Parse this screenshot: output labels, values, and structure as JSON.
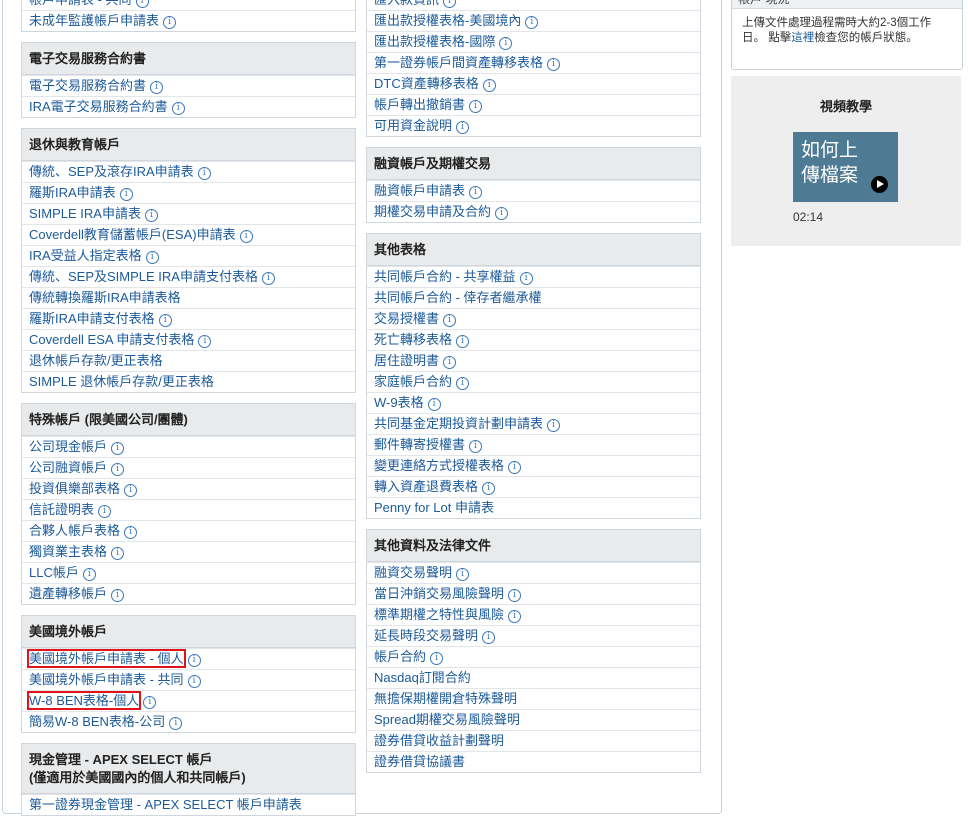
{
  "left_column": [
    {
      "heading": "",
      "items": [
        {
          "label": "帳戶申請表 - 共同",
          "info": true
        },
        {
          "label": "未成年監護帳戶申請表",
          "info": true
        }
      ]
    },
    {
      "heading": "電子交易服務合約書",
      "items": [
        {
          "label": "電子交易服務合約書",
          "info": true
        },
        {
          "label": "IRA電子交易服務合約書",
          "info": true
        }
      ]
    },
    {
      "heading": "退休與教育帳戶",
      "items": [
        {
          "label": "傳統、SEP及滾存IRA申請表",
          "info": true
        },
        {
          "label": "羅斯IRA申請表",
          "info": true
        },
        {
          "label": "SIMPLE IRA申請表",
          "info": true
        },
        {
          "label": "Coverdell教育儲蓄帳戶(ESA)申請表",
          "info": true
        },
        {
          "label": "IRA受益人指定表格",
          "info": true
        },
        {
          "label": "傳統、SEP及SIMPLE IRA申請支付表格",
          "info": true
        },
        {
          "label": "傳統轉換羅斯IRA申請表格",
          "info": false
        },
        {
          "label": "羅斯IRA申請支付表格",
          "info": true
        },
        {
          "label": "Coverdell ESA 申請支付表格",
          "info": true
        },
        {
          "label": "退休帳戶存款/更正表格",
          "info": false
        },
        {
          "label": "SIMPLE 退休帳戶存款/更正表格",
          "info": false
        }
      ]
    },
    {
      "heading": "特殊帳戶 (限美國公司/團體)",
      "items": [
        {
          "label": "公司現金帳戶",
          "info": true
        },
        {
          "label": "公司融資帳戶",
          "info": true
        },
        {
          "label": "投資俱樂部表格",
          "info": true
        },
        {
          "label": "信託證明表",
          "info": true
        },
        {
          "label": "合夥人帳戶表格",
          "info": true
        },
        {
          "label": "獨資業主表格",
          "info": true
        },
        {
          "label": "LLC帳戶",
          "info": true
        },
        {
          "label": "遺產轉移帳戶",
          "info": true
        }
      ]
    },
    {
      "heading": "美國境外帳戶",
      "items": [
        {
          "label": "美國境外帳戶申請表 - 個人",
          "info": true,
          "highlight": true
        },
        {
          "label": "美國境外帳戶申請表 - 共同",
          "info": true
        },
        {
          "label": "W-8 BEN表格-個人",
          "info": true,
          "highlight": true
        },
        {
          "label": "簡易W-8 BEN表格-公司",
          "info": true
        }
      ]
    },
    {
      "heading": "現金管理 - APEX SELECT 帳戶",
      "subheading": "(僅適用於美國國內的個人和共同帳戶)",
      "items": [
        {
          "label": "第一證券現金管理 - APEX SELECT 帳戶申請表",
          "info": false
        }
      ]
    }
  ],
  "mid_column": [
    {
      "heading": "",
      "items": [
        {
          "label": "匯入款資訊",
          "info": true
        },
        {
          "label": "匯出款授權表格-美國境內",
          "info": true
        },
        {
          "label": "匯出款授權表格-國際",
          "info": true
        },
        {
          "label": "第一證券帳戶間資產轉移表格",
          "info": true
        },
        {
          "label": "DTC資產轉移表格",
          "info": true
        },
        {
          "label": "帳戶轉出撤銷書",
          "info": true
        },
        {
          "label": "可用資金說明",
          "info": true
        }
      ]
    },
    {
      "heading": "融資帳戶及期權交易",
      "items": [
        {
          "label": "融資帳戶申請表",
          "info": true
        },
        {
          "label": "期權交易申請及合約",
          "info": true
        }
      ]
    },
    {
      "heading": "其他表格",
      "items": [
        {
          "label": "共同帳戶合約 - 共享權益",
          "info": true
        },
        {
          "label": "共同帳戶合約 - 倖存者繼承權",
          "info": false
        },
        {
          "label": "交易授權書",
          "info": true
        },
        {
          "label": "死亡轉移表格",
          "info": true
        },
        {
          "label": "居住證明書",
          "info": true
        },
        {
          "label": "家庭帳戶合約",
          "info": true
        },
        {
          "label": "W-9表格",
          "info": true
        },
        {
          "label": "共同基金定期投資計劃申請表",
          "info": true
        },
        {
          "label": "郵件轉寄授權書",
          "info": true
        },
        {
          "label": "變更連絡方式授權表格",
          "info": true
        },
        {
          "label": "轉入資產退費表格",
          "info": true
        },
        {
          "label": "Penny for Lot 申請表",
          "info": false
        }
      ]
    },
    {
      "heading": "其他資料及法律文件",
      "items": [
        {
          "label": "融資交易聲明",
          "info": true
        },
        {
          "label": "當日沖銷交易風險聲明",
          "info": true
        },
        {
          "label": "標準期權之特性與風險",
          "info": true
        },
        {
          "label": "延長時段交易聲明",
          "info": true
        },
        {
          "label": "帳戶合約",
          "info": true
        },
        {
          "label": "Nasdaq訂閱合約",
          "info": false
        },
        {
          "label": "無擔保期權開倉特殊聲明",
          "info": false
        },
        {
          "label": "Spread期權交易風險聲明",
          "info": false
        },
        {
          "label": "證券借貸收益計劃聲明",
          "info": false
        },
        {
          "label": "證券借貸協議書",
          "info": false
        }
      ]
    }
  ],
  "status_panel": {
    "title": "帳戶 現況",
    "text_before": "上傳文件處理過程需時大約2-3個工作日。 點擊",
    "link": "這裡",
    "text_after": "檢查您的帳戶狀態。"
  },
  "video": {
    "title": "視頻教學",
    "thumb_line1": "如何上",
    "thumb_line2": "傳檔案",
    "duration": "02:14"
  },
  "icons": {
    "info": "info-icon",
    "play": "play-icon"
  },
  "colors": {
    "link": "#1c5a9a",
    "highlight": "#e0141b",
    "section_header": "#e8eaec",
    "video_thumb": "#4e7a93"
  }
}
